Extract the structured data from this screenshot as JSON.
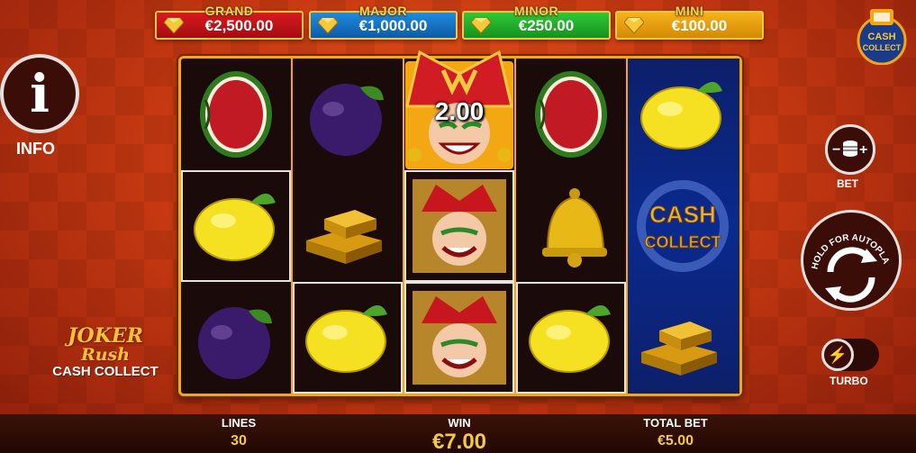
{
  "jackpots": {
    "grand": {
      "label": "GRAND",
      "value": "€2,500.00",
      "color": "#d81a20"
    },
    "major": {
      "label": "MAJOR",
      "value": "€1,000.00",
      "color": "#1e8cde"
    },
    "minor": {
      "label": "MINOR",
      "value": "€250.00",
      "color": "#2ec83a"
    },
    "mini": {
      "label": "MINI",
      "value": "€100.00",
      "color": "#f4b21a"
    }
  },
  "info": {
    "label": "INFO",
    "icon": "info-icon"
  },
  "reels": [
    [
      "watermelon",
      "lemon",
      "plum"
    ],
    [
      "plum",
      "gold-bars",
      "lemon"
    ],
    [
      "joker",
      "joker",
      "joker"
    ],
    [
      "watermelon",
      "bell",
      "lemon"
    ],
    [
      "lemon",
      "cash-collect",
      "gold-bars"
    ]
  ],
  "joker_multiplier": "2.00",
  "cash_collect_symbol": {
    "line1": "CASH",
    "line2": "COLLECT"
  },
  "controls": {
    "bet_label": "BET",
    "autoplay_text": "HOLD FOR AUTOPLAY",
    "turbo_label": "TURBO"
  },
  "badge": {
    "line1": "CASH",
    "line2": "COLLECT"
  },
  "logo": {
    "line1": "JOKER",
    "line2": "Rush",
    "line3": "CASH COLLECT"
  },
  "bottom": {
    "lines_label": "LINES",
    "lines_value": "30",
    "win_label": "WIN",
    "win_value": "€7.00",
    "total_bet_label": "TOTAL BET",
    "total_bet_value": "€5.00"
  }
}
